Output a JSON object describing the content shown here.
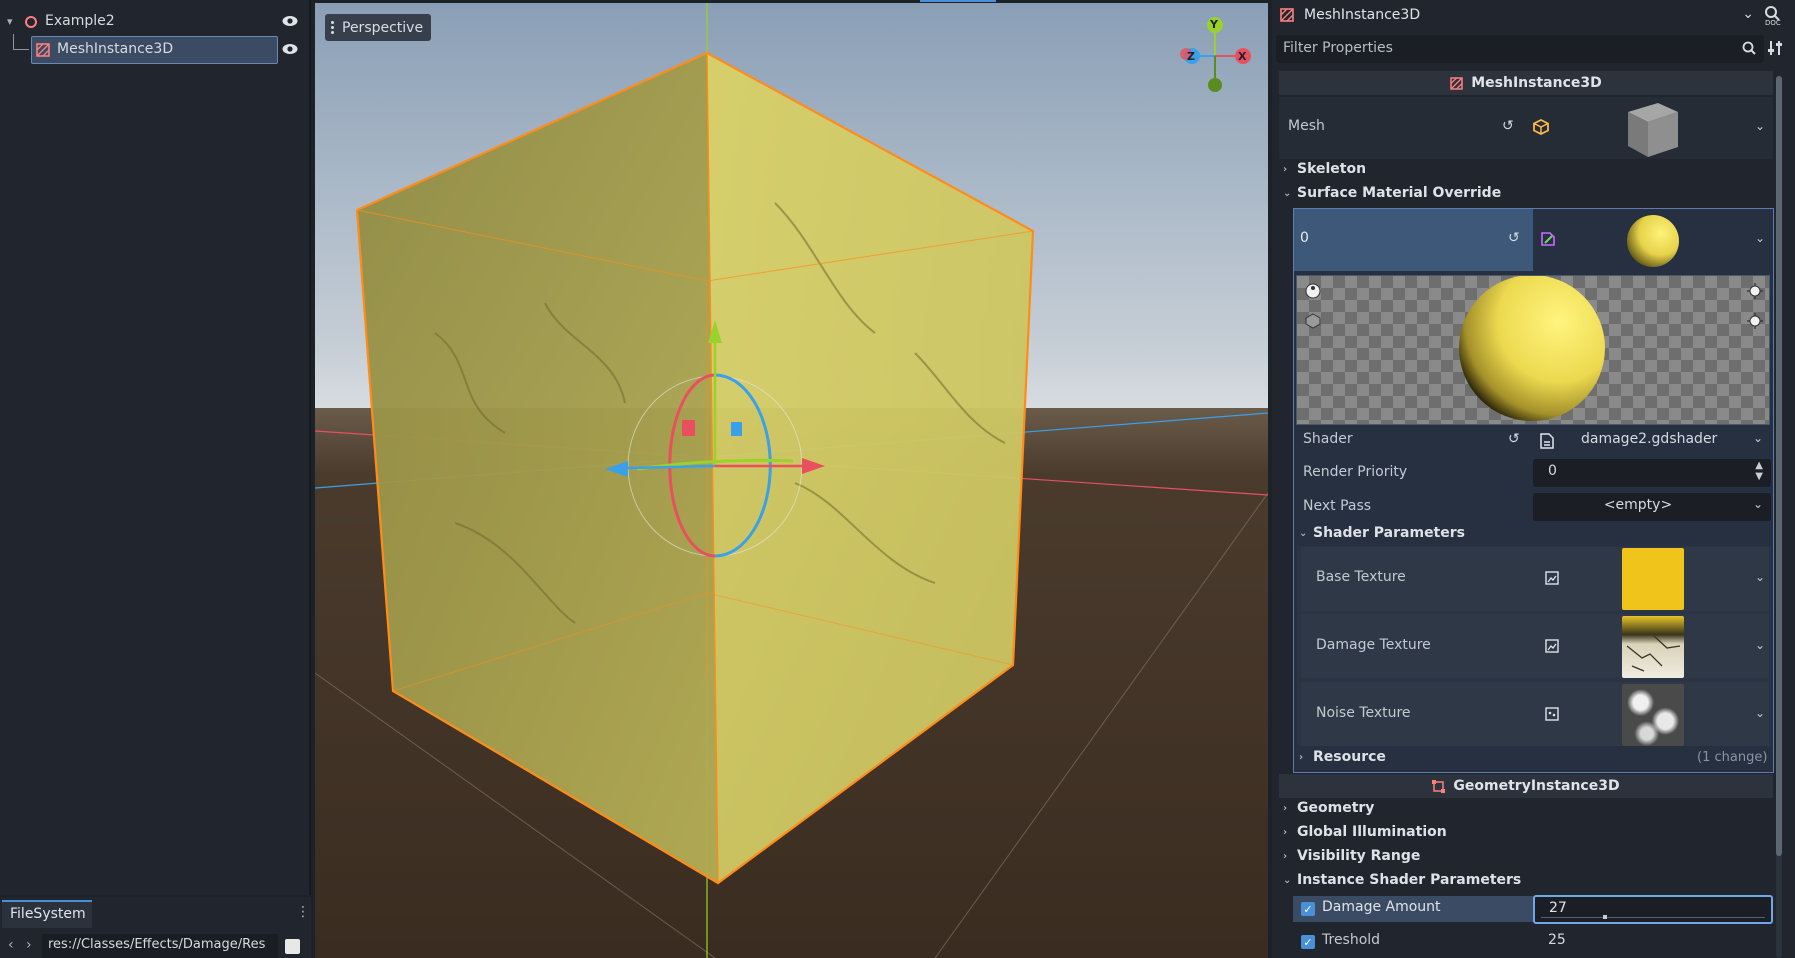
{
  "scene_tree": {
    "root": {
      "label": "Example2",
      "icon": "node3d-circle-icon"
    },
    "child": {
      "label": "MeshInstance3D",
      "icon": "mesh-instance-icon"
    }
  },
  "filesystem": {
    "tab_label": "FileSystem",
    "path": "res://Classes/Effects/Damage/Res"
  },
  "viewport": {
    "view_mode": "Perspective",
    "gizmo_axes": {
      "x": "X",
      "y": "Y",
      "z": "Z"
    },
    "colors": {
      "sky_top": "#8a9fb6",
      "sky_horizon": "#cfd6dd",
      "ground": "#3f3226",
      "cube": "#c9c14e",
      "outline": "#ff8c1a"
    }
  },
  "inspector": {
    "object_name": "MeshInstance3D",
    "filter_placeholder": "Filter Properties",
    "class_header": "MeshInstance3D",
    "mesh_label": "Mesh",
    "categories": {
      "skeleton": "Skeleton",
      "surface_material_override": "Surface Material Override"
    },
    "surface_index": "0",
    "shader_label": "Shader",
    "shader_value": "damage2.gdshader",
    "render_priority_label": "Render Priority",
    "render_priority_value": "0",
    "next_pass_label": "Next Pass",
    "next_pass_value": "<empty>",
    "shader_parameters_label": "Shader Parameters",
    "textures": [
      {
        "label": "Base Texture"
      },
      {
        "label": "Damage Texture"
      },
      {
        "label": "Noise Texture"
      }
    ],
    "resource_label": "Resource",
    "resource_note": "(1 change)",
    "geometry_header": "GeometryInstance3D",
    "geometry_categories": [
      "Geometry",
      "Global Illumination",
      "Visibility Range",
      "Instance Shader Parameters"
    ],
    "instance_params": [
      {
        "label": "Damage Amount",
        "value": "27",
        "checked": true
      },
      {
        "label": "Treshold",
        "value": "25",
        "checked": true
      }
    ],
    "accent_color": "#4a90d9"
  }
}
